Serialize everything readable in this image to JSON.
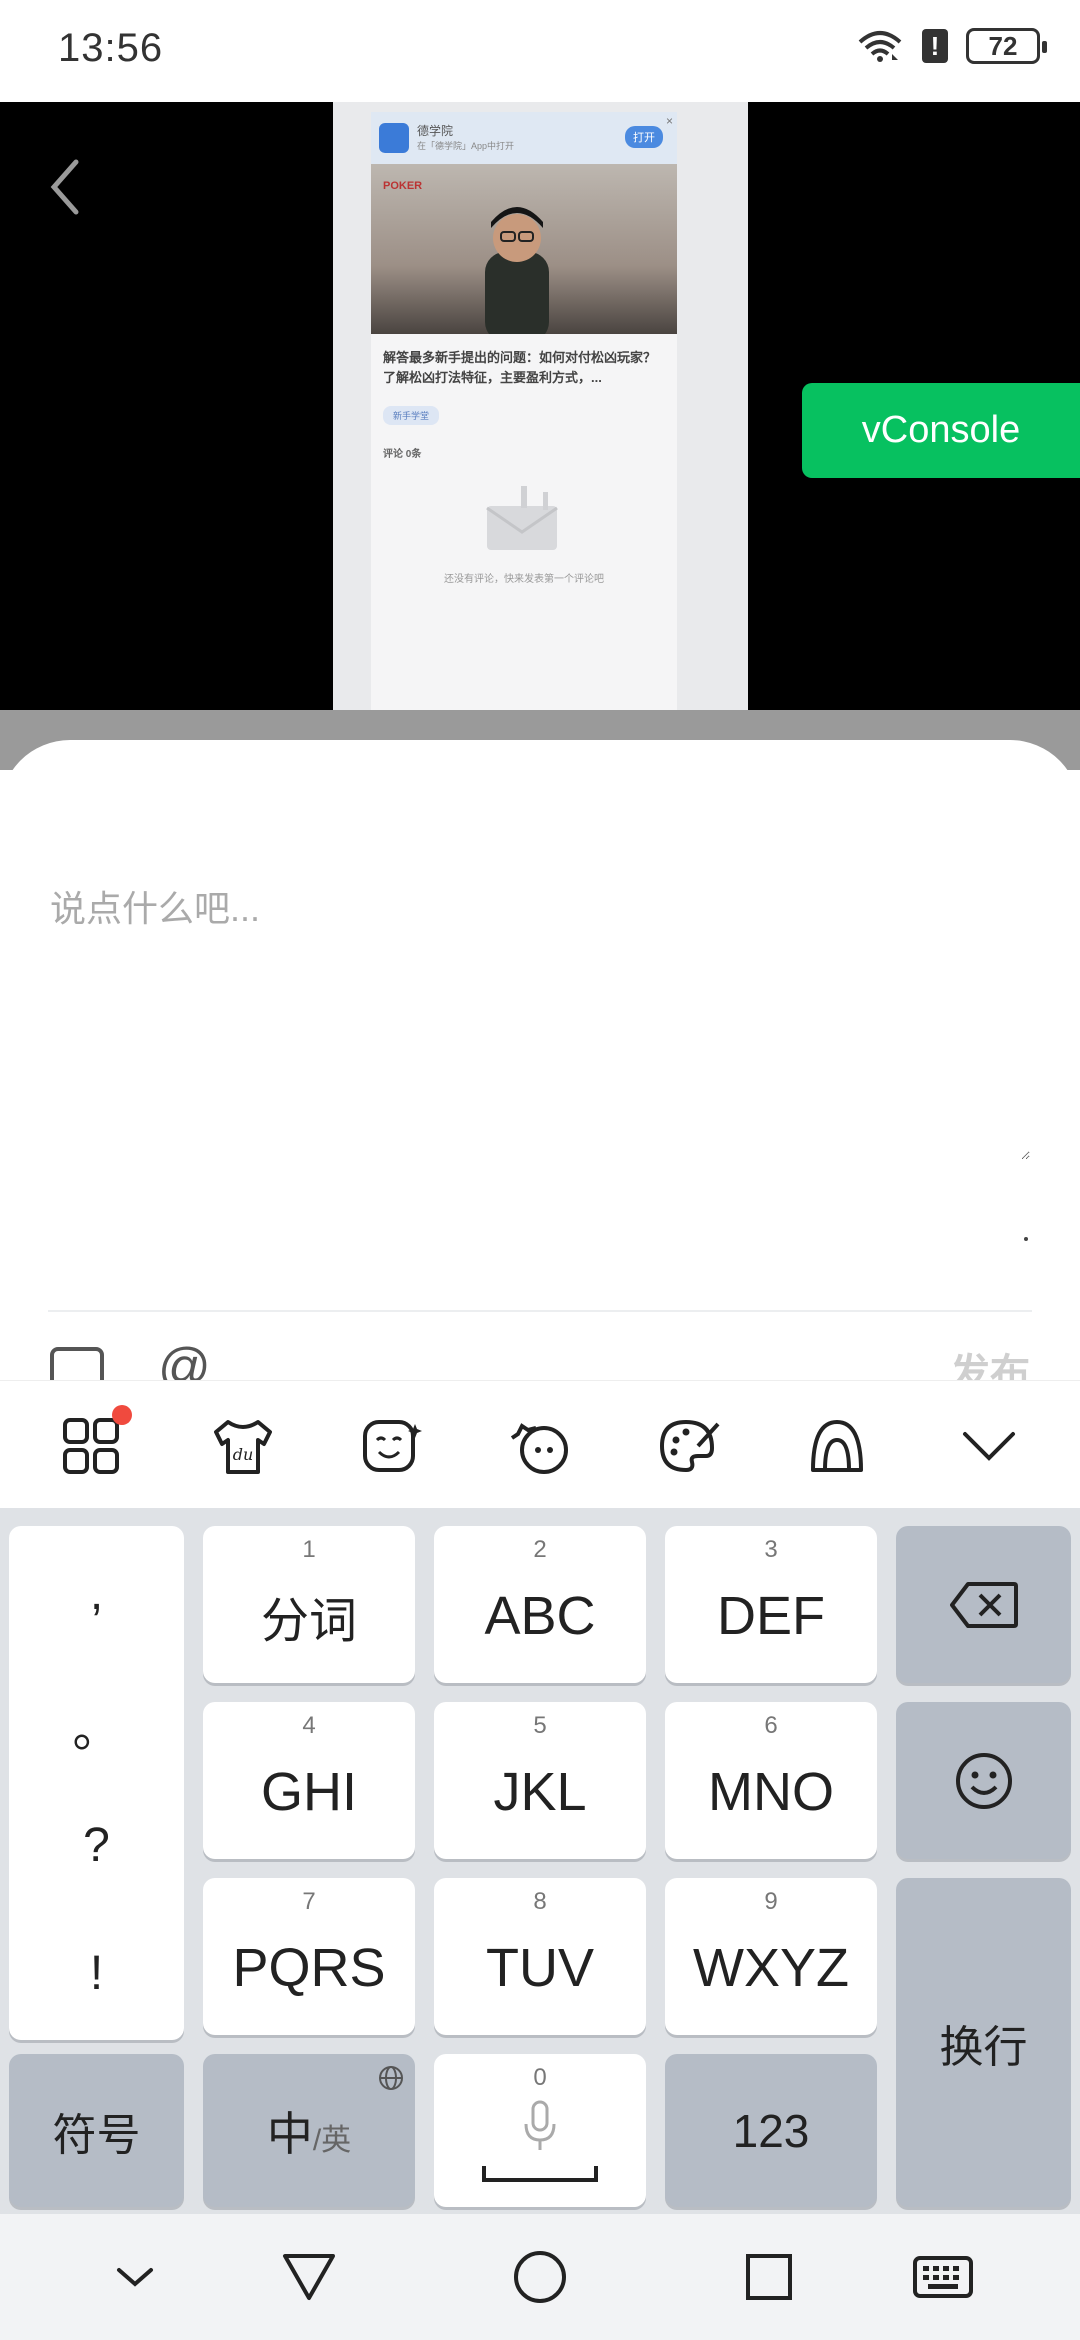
{
  "status_bar": {
    "time": "13:56",
    "battery": "72",
    "alert": "!"
  },
  "video_preview": {
    "banner_title": "德学院",
    "banner_sub": "在「德学院」App中打开",
    "banner_open": "打开",
    "banner_close": "×",
    "brand_text": "POKER",
    "headline": "解答最多新手提出的问题：如何对付松凶玩家？了解松凶打法特征，主要盈利方式，...",
    "tag": "新手学堂",
    "comments_count": "评论 0条",
    "empty_text": "还没有评论，快来发表第一个评论吧"
  },
  "vconsole": {
    "label": "vConsole"
  },
  "comment_sheet": {
    "placeholder": "说点什么吧...",
    "at_symbol": "@",
    "publish": "发布"
  },
  "keyboard_toolbar": {
    "items": [
      "apps-grid-icon",
      "du-shirt-icon",
      "emoji-face-icon",
      "sticker-icon",
      "palette-icon",
      "gesture-icon",
      "chevron-down-icon"
    ],
    "notification_color": "#f04a3e"
  },
  "keyboard": {
    "punctuation": [
      ",",
      "。",
      "?",
      "!"
    ],
    "keys": [
      {
        "num": "1",
        "label": "分词"
      },
      {
        "num": "2",
        "label": "ABC"
      },
      {
        "num": "3",
        "label": "DEF"
      },
      {
        "num": "4",
        "label": "GHI"
      },
      {
        "num": "5",
        "label": "JKL"
      },
      {
        "num": "6",
        "label": "MNO"
      },
      {
        "num": "7",
        "label": "PQRS"
      },
      {
        "num": "8",
        "label": "TUV"
      },
      {
        "num": "9",
        "label": "WXYZ"
      }
    ],
    "symbols": "符号",
    "lang_main": "中",
    "lang_alt": "/英",
    "space_num": "0",
    "numbers": "123",
    "enter": "换行"
  },
  "nav_bar": {
    "items": [
      "hide-keyboard-icon",
      "back-triangle-icon",
      "home-circle-icon",
      "recents-square-icon",
      "keyboard-icon"
    ]
  },
  "colors": {
    "accent_green": "#07c160",
    "key_bg": "#ffffff",
    "func_key_bg": "#b5bcc6",
    "keyboard_bg": "#dfe2e6"
  }
}
